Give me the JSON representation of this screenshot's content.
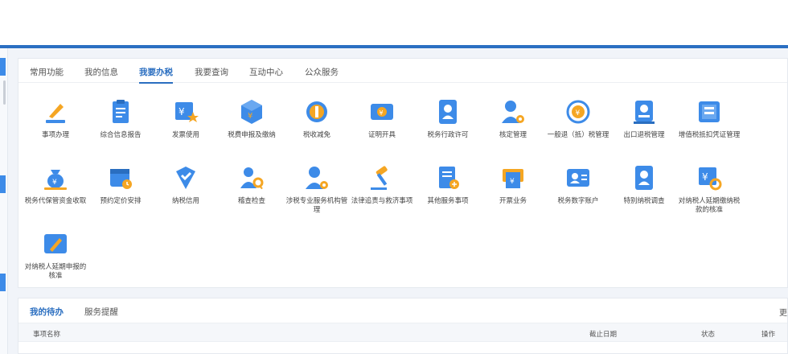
{
  "tabs": [
    "常用功能",
    "我的信息",
    "我要办税",
    "我要查询",
    "互动中心",
    "公众服务"
  ],
  "active_tab": "我要办税",
  "items": [
    {
      "label": "事项办理",
      "icon": "pen-icon"
    },
    {
      "label": "综合信息报告",
      "icon": "clipboard-icon"
    },
    {
      "label": "发票使用",
      "icon": "invoice-star-icon"
    },
    {
      "label": "税费申报及缴纳",
      "icon": "tax-declaration-icon"
    },
    {
      "label": "税收减免",
      "icon": "tax-relief-icon"
    },
    {
      "label": "证明开具",
      "icon": "certificate-icon"
    },
    {
      "label": "税务行政许可",
      "icon": "admin-license-icon"
    },
    {
      "label": "核定管理",
      "icon": "person-gear-icon"
    },
    {
      "label": "一般退（抵）税管理",
      "icon": "refund-yen-icon"
    },
    {
      "label": "出口退税管理",
      "icon": "export-refund-icon"
    },
    {
      "label": "增值税抵扣凭证管理",
      "icon": "vat-voucher-icon"
    },
    {
      "label": "税务代保管资金收取",
      "icon": "money-bag-icon"
    },
    {
      "label": "预约定价安排",
      "icon": "calendar-clock-icon"
    },
    {
      "label": "纳税信用",
      "icon": "credit-badge-icon"
    },
    {
      "label": "稽查检查",
      "icon": "inspection-icon"
    },
    {
      "label": "涉税专业服务机构管理",
      "icon": "agency-gear-icon"
    },
    {
      "label": "法律追责与救济事项",
      "icon": "gavel-icon"
    },
    {
      "label": "其他服务事项",
      "icon": "other-service-icon"
    },
    {
      "label": "开票业务",
      "icon": "invoicing-icon"
    },
    {
      "label": "税务数字账户",
      "icon": "digital-account-icon"
    },
    {
      "label": "特别纳税调查",
      "icon": "special-investigation-icon"
    },
    {
      "label": "对纳税人延期缴纳税款的核准",
      "icon": "deferred-payment-icon"
    },
    {
      "label": "对纳税人延期申报的核准",
      "icon": "deferred-filing-icon"
    }
  ],
  "todo": {
    "tabs": [
      "我的待办",
      "服务提醒"
    ],
    "more": "更多",
    "headers": [
      "事项名称",
      "截止日期",
      "状态",
      "操作"
    ]
  },
  "colors": {
    "accent": "#2a6ec0",
    "icon_blue": "#3d8be8",
    "icon_orange": "#f5a623"
  }
}
